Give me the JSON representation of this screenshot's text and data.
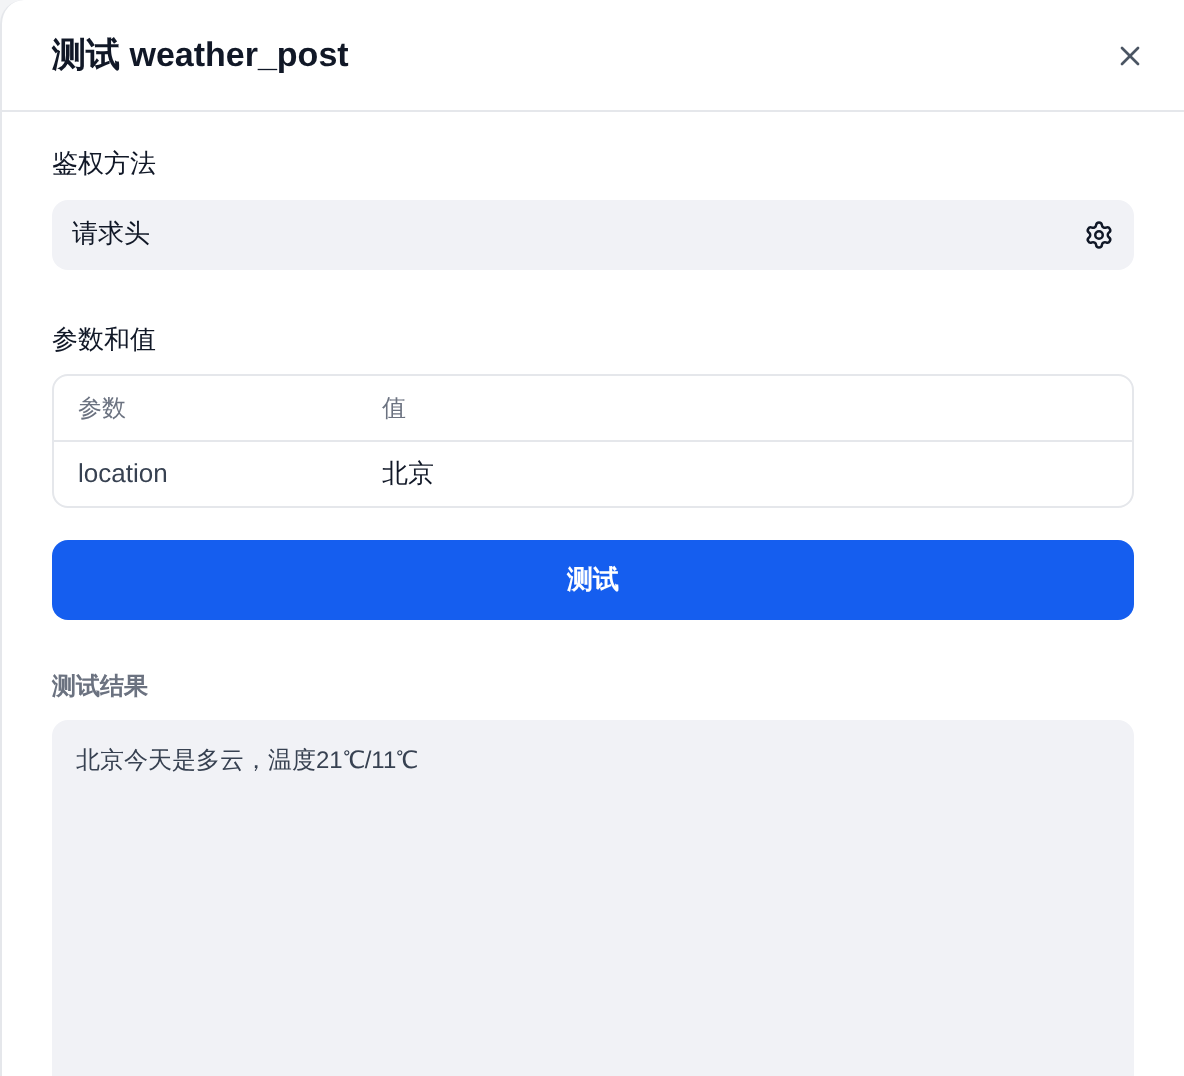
{
  "dialog": {
    "title": "测试 weather_post"
  },
  "auth": {
    "label": "鉴权方法",
    "value": "请求头"
  },
  "params": {
    "label": "参数和值",
    "columns": [
      "参数",
      "值"
    ],
    "rows": [
      {
        "name": "location",
        "value": "北京"
      }
    ]
  },
  "test_button": "测试",
  "result": {
    "label": "测试结果",
    "text": "北京今天是多云，温度21℃/11℃"
  }
}
